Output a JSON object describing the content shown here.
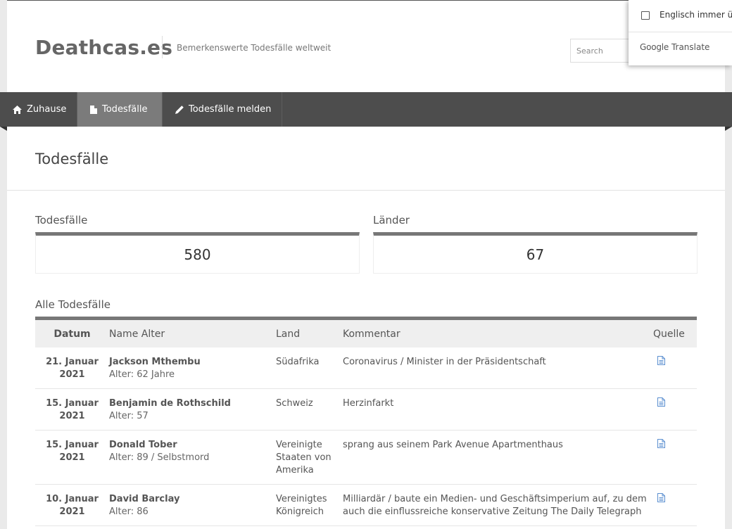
{
  "site": {
    "logo": "Deathcas.es",
    "tagline": "Bemerkenswerte Todesfälle weltweit",
    "search_placeholder": "Search"
  },
  "translate_popup": {
    "checkbox_label": "Englisch immer übersetzen",
    "google": "Google",
    "translate": "Translate"
  },
  "nav": [
    {
      "label": "Zuhause",
      "icon": "home-icon"
    },
    {
      "label": "Todesfälle",
      "icon": "document-icon",
      "active": true
    },
    {
      "label": "Todesfälle melden",
      "icon": "pencil-icon"
    }
  ],
  "page": {
    "title": "Todesfälle"
  },
  "stats": {
    "deaths_label": "Todesfälle",
    "deaths_value": "580",
    "countries_label": "Länder",
    "countries_value": "67"
  },
  "table": {
    "section_title": "Alle Todesfälle",
    "headers": [
      "Datum",
      "Name Alter",
      "Land",
      "Kommentar",
      "Quelle"
    ],
    "rows": [
      {
        "date_day": "21. Januar",
        "date_year": "2021",
        "name": "Jackson Mthembu",
        "age": "Alter: 62 Jahre",
        "country": "Südafrika",
        "comment": "Coronavirus / Minister in der Präsidentschaft"
      },
      {
        "date_day": "15. Januar",
        "date_year": "2021",
        "name": "Benjamin de Rothschild",
        "age": "Alter: 57",
        "country": "Schweiz",
        "comment": "Herzinfarkt"
      },
      {
        "date_day": "15. Januar",
        "date_year": "2021",
        "name": "Donald Tober",
        "age": "Alter: 89 / Selbstmord",
        "country": "Vereinigte Staaten von Amerika",
        "comment": "sprang aus seinem Park Avenue Apartmenthaus"
      },
      {
        "date_day": "10. Januar",
        "date_year": "2021",
        "name": "David Barclay",
        "age": "Alter: 86",
        "country": "Vereinigtes Königreich",
        "comment": "Milliardär / baute ein Medien- und Geschäftsimperium auf, zu dem auch die einflussreiche konservative Zeitung The Daily Telegraph"
      }
    ]
  },
  "colors": {
    "nav_bg": "#4d4d4d",
    "nav_active": "#7b7b7b",
    "link_icon": "#5b8fd0"
  }
}
